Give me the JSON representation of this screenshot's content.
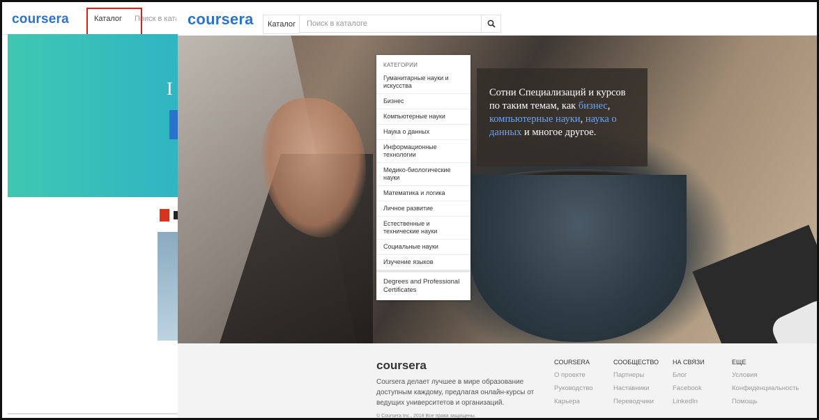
{
  "background_page": {
    "logo": "coursera",
    "catalog_label": "Каталог",
    "search_placeholder": "Поиск в каталоге"
  },
  "header": {
    "logo": "coursera",
    "catalog_label": "Каталог",
    "search_placeholder": "Поиск в каталоге",
    "search_icon": "search-icon"
  },
  "dropdown": {
    "heading": "КАТЕГОРИИ",
    "items": [
      "Гуманитарные науки и искусства",
      "Бизнес",
      "Компьютерные науки",
      "Наука о данных",
      "Информационные технологии",
      "Медико-биологические науки",
      "Математика и логика",
      "Личное развитие",
      "Естественные и технические науки",
      "Социальные науки",
      "Изучение языков"
    ],
    "degrees": "Degrees and Professional Certificates"
  },
  "promo": {
    "text1": "Сотни Специализаций и курсов по таким темам, как",
    "link1": "бизнес",
    "sep1": ",",
    "link2": "компьютерные науки",
    "sep2": ",",
    "link3": "наука о данных",
    "text2": "и многое другое."
  },
  "footer": {
    "logo": "coursera",
    "description": "Coursera делает лучшее в мире образование доступным каждому, предлагая онлайн-курсы от ведущих университетов и организаций.",
    "copyright": "© Coursera Inc., 2018 Все права защищены.",
    "columns": [
      {
        "title": "COURSERA",
        "items": [
          "О проекте",
          "Руководство",
          "Карьера"
        ]
      },
      {
        "title": "СООБЩЕСТВО",
        "items": [
          "Партнеры",
          "Наставники",
          "Переводчики"
        ]
      },
      {
        "title": "НА СВЯЗИ",
        "items": [
          "Блог",
          "Facebook",
          "LinkedIn"
        ]
      },
      {
        "title": "ЕЩЕ",
        "items": [
          "Условия",
          "Конфиденциальность",
          "Помощь"
        ]
      }
    ]
  },
  "colors": {
    "brand": "#2a73cc",
    "highlight_box": "#e21b1b",
    "link": "#6aa4f3"
  }
}
